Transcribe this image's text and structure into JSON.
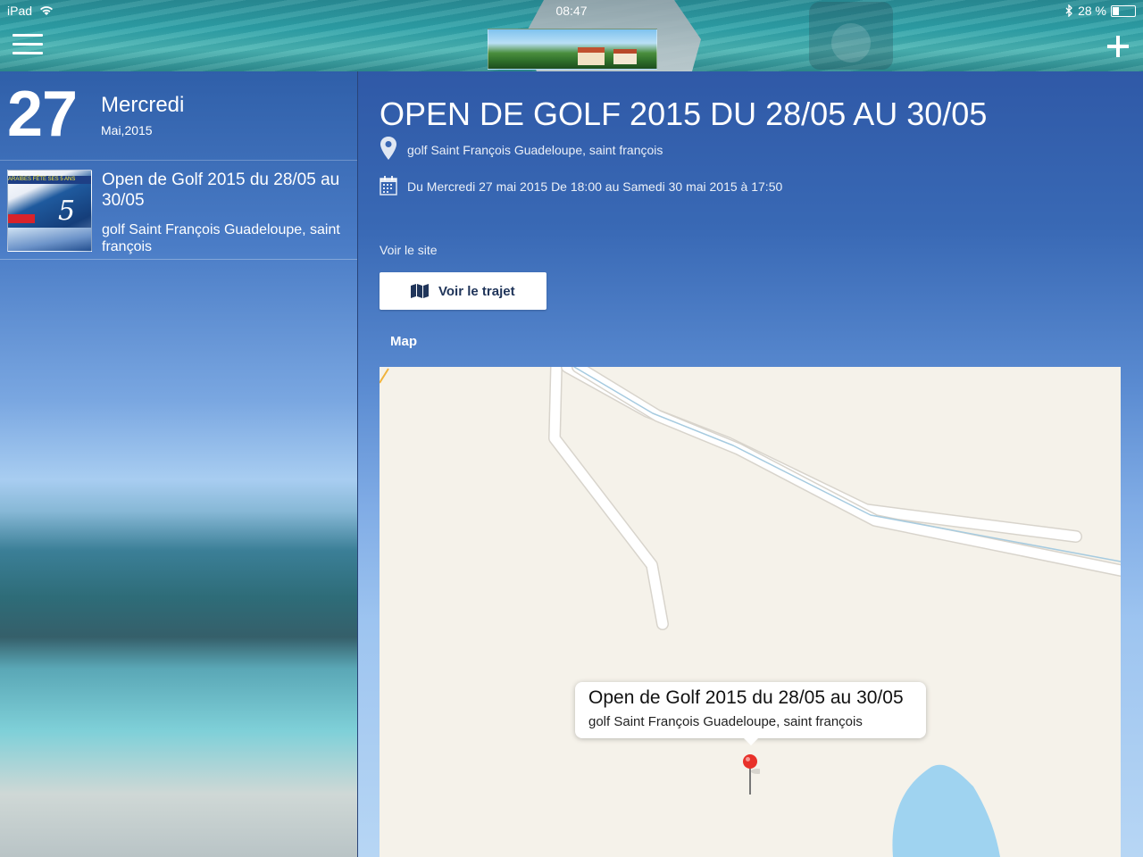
{
  "status_bar": {
    "carrier": "iPad",
    "time": "08:47",
    "battery": "28 %",
    "battery_level": 0.28
  },
  "header": {
    "menu_icon": "hamburger-menu-icon",
    "add_icon": "plus-icon"
  },
  "day_header": {
    "day_number": "27",
    "weekday": "Mercredi",
    "month_year": "Mai,2015"
  },
  "events": [
    {
      "title": "Open de Golf 2015 du 28/05 au 30/05",
      "place": "golf Saint François Guadeloupe, saint françois",
      "thumb_band": "ARAÏBES FÊTE SES 5 ANS"
    }
  ],
  "detail": {
    "title": "OPEN DE GOLF 2015 DU 28/05 AU 30/05",
    "location": "golf Saint François Guadeloupe, saint françois",
    "date_range": "Du Mercredi 27 mai 2015 De 18:00 au Samedi 30 mai 2015 à 17:50",
    "site_link": "Voir le site",
    "route_button": "Voir le trajet",
    "map_label": "Map"
  },
  "map_callout": {
    "title": "Open de Golf 2015 du 28/05 au 30/05",
    "subtitle": "golf Saint François Guadeloupe, saint françois"
  },
  "colors": {
    "pin": "#e8312a",
    "water": "#9fd3f0",
    "road": "#ffffff",
    "map_land": "#f5f2ea"
  }
}
